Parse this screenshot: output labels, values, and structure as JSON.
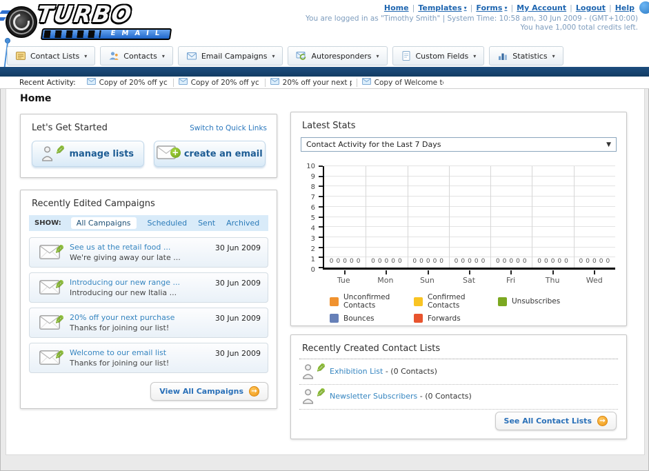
{
  "colors": {
    "accent": "#2a70b8",
    "navy": "#133d66"
  },
  "logo": {
    "word": "TURBO",
    "sub": "EMAIL"
  },
  "header": {
    "links": [
      {
        "label": "Home",
        "dropdown": false
      },
      {
        "label": "Templates",
        "dropdown": true
      },
      {
        "label": "Forms",
        "dropdown": true
      },
      {
        "label": "My Account",
        "dropdown": false
      },
      {
        "label": "Logout",
        "dropdown": false
      },
      {
        "label": "Help",
        "dropdown": false
      }
    ],
    "login_line": "You are logged in as \"Timothy Smith\" | System Time: 10:58 am, 30 Jun 2009 - (GMT+10:00)",
    "credits_line": "You have 1,000 total credits left."
  },
  "nav_tabs": [
    {
      "label": "Contact Lists",
      "icon": "contact-lists-icon"
    },
    {
      "label": "Contacts",
      "icon": "contacts-icon"
    },
    {
      "label": "Email Campaigns",
      "icon": "email-campaigns-icon"
    },
    {
      "label": "Autoresponders",
      "icon": "autoresponders-icon"
    },
    {
      "label": "Custom Fields",
      "icon": "custom-fields-icon"
    },
    {
      "label": "Statistics",
      "icon": "statistics-icon"
    }
  ],
  "recent_activity": {
    "label": "Recent Activity:",
    "items": [
      "Copy of 20% off yc",
      "Copy of 20% off yc",
      "20% off your next p",
      "Copy of Welcome tc"
    ]
  },
  "page_title": "Home",
  "get_started": {
    "title": "Let's Get Started",
    "switch_link": "Switch to Quick Links",
    "buttons": [
      {
        "label": "manage lists"
      },
      {
        "label": "create an email"
      }
    ]
  },
  "campaigns": {
    "title": "Recently Edited Campaigns",
    "show_label": "SHOW:",
    "filters": [
      "All Campaigns",
      "Scheduled",
      "Sent",
      "Archived"
    ],
    "active_filter": "All Campaigns",
    "items": [
      {
        "title": "See us at the retail food ...",
        "subtitle": "We're giving away our late ...",
        "date": "30 Jun 2009"
      },
      {
        "title": "Introducing our new range ...",
        "subtitle": "Introducing our new Italia ...",
        "date": "30 Jun 2009"
      },
      {
        "title": "20% off your next purchase",
        "subtitle": "Thanks for joining our list!",
        "date": "30 Jun 2009"
      },
      {
        "title": "Welcome to our email list",
        "subtitle": "Thanks for joining our list!",
        "date": "30 Jun 2009"
      }
    ],
    "view_all_label": "View All Campaigns"
  },
  "latest_stats": {
    "title": "Latest Stats",
    "dropdown_value": "Contact Activity for the Last 7 Days"
  },
  "chart_data": {
    "type": "bar",
    "title": "Contact Activity for the Last 7 Days",
    "categories": [
      "Tue",
      "Mon",
      "Sun",
      "Sat",
      "Fri",
      "Thu",
      "Wed"
    ],
    "series": [
      {
        "name": "Unconfirmed Contacts",
        "color": "#F0922F",
        "values": [
          0,
          0,
          0,
          0,
          0,
          0,
          0
        ]
      },
      {
        "name": "Confirmed Contacts",
        "color": "#F9C423",
        "values": [
          0,
          0,
          0,
          0,
          0,
          0,
          0
        ]
      },
      {
        "name": "Unsubscribes",
        "color": "#7CA821",
        "values": [
          0,
          0,
          0,
          0,
          0,
          0,
          0
        ]
      },
      {
        "name": "Bounces",
        "color": "#6680B8",
        "values": [
          0,
          0,
          0,
          0,
          0,
          0,
          0
        ]
      },
      {
        "name": "Forwards",
        "color": "#E8542E",
        "values": [
          0,
          0,
          0,
          0,
          0,
          0,
          0
        ]
      }
    ],
    "xlabel": "",
    "ylabel": "",
    "ylim": [
      0,
      10
    ],
    "yticks": [
      0,
      1,
      2,
      3,
      4,
      5,
      6,
      7,
      8,
      9,
      10
    ],
    "grid": true,
    "legend_position": "bottom"
  },
  "contact_lists": {
    "title": "Recently Created Contact Lists",
    "items": [
      {
        "name": "Exhibition List",
        "detail": " - (0 Contacts)"
      },
      {
        "name": "Newsletter Subscribers",
        "detail": " - (0 Contacts)"
      }
    ],
    "see_all_label": "See All Contact Lists"
  }
}
